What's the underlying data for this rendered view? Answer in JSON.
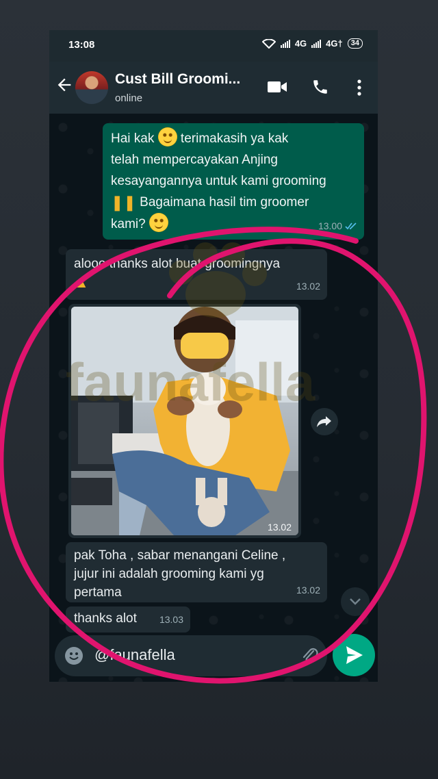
{
  "status_bar": {
    "time": "13:08",
    "net1": "4G",
    "net2": "4G†",
    "battery": "34"
  },
  "header": {
    "title": "Cust Bill Groomi...",
    "subtitle": "online"
  },
  "messages": [
    {
      "dir": "out",
      "lines": [
        "Hai kak",
        "terimakasih ya kak",
        "telah mempercayakan Anjing",
        "kesayangannya untuk kami grooming",
        "Bagaimana hasil tim groomer",
        "kami?"
      ],
      "time": "13.00"
    },
    {
      "dir": "in",
      "text": "alooo thanks alot buat groomingnya",
      "time": "13.02"
    },
    {
      "dir": "in",
      "type": "image",
      "time": "13.02"
    },
    {
      "dir": "in",
      "lines": [
        "pak Toha , sabar menangani Celine ,",
        "jujur ini adalah grooming kami yg",
        "pertama"
      ],
      "time": "13.02"
    },
    {
      "dir": "in",
      "text": "thanks alot",
      "time": "13.03"
    }
  ],
  "input": {
    "value": "@faunafella"
  },
  "colors": {
    "accent": "#00a884",
    "outgoing": "#005c4b",
    "incoming": "#202c33",
    "circle": "#e0146e"
  },
  "icons": [
    "back-arrow-icon",
    "video-call-icon",
    "phone-call-icon",
    "more-options-icon",
    "forward-icon",
    "emoji-icon",
    "attach-icon",
    "send-icon",
    "read-receipt-icon"
  ]
}
